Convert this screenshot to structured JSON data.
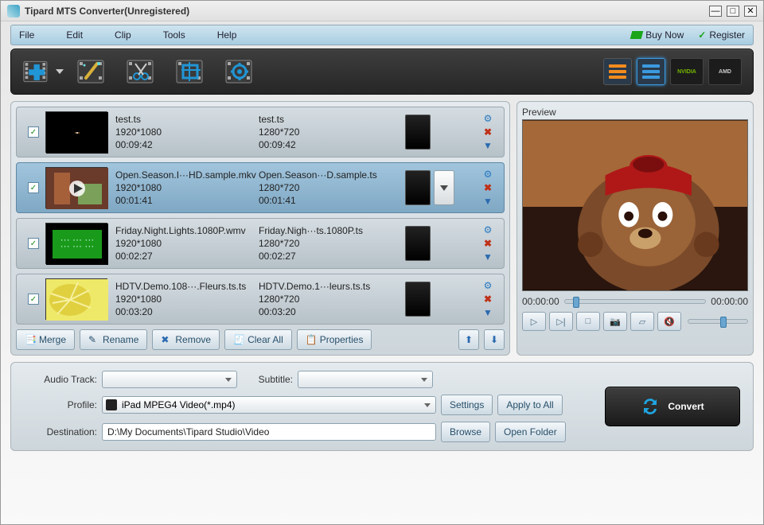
{
  "window": {
    "title": "Tipard MTS Converter(Unregistered)"
  },
  "menu": {
    "file": "File",
    "edit": "Edit",
    "clip": "Clip",
    "tools": "Tools",
    "help": "Help",
    "buy_now": "Buy Now",
    "register": "Register"
  },
  "filelist": {
    "rows": [
      {
        "checked": "✓",
        "src_name": "test.ts",
        "src_res": "1920*1080",
        "src_dur": "00:09:42",
        "out_name": "test.ts",
        "out_res": "1280*720",
        "out_dur": "00:09:42"
      },
      {
        "checked": "✓",
        "src_name": "Open.Season.I···HD.sample.mkv",
        "src_res": "1920*1080",
        "src_dur": "00:01:41",
        "out_name": "Open.Season···D.sample.ts",
        "out_res": "1280*720",
        "out_dur": "00:01:41"
      },
      {
        "checked": "✓",
        "src_name": "Friday.Night.Lights.1080P.wmv",
        "src_res": "1920*1080",
        "src_dur": "00:02:27",
        "out_name": "Friday.Nigh···ts.1080P.ts",
        "out_res": "1280*720",
        "out_dur": "00:02:27"
      },
      {
        "checked": "✓",
        "src_name": "HDTV.Demo.108···.Fleurs.ts.ts",
        "src_res": "1920*1080",
        "src_dur": "00:03:20",
        "out_name": "HDTV.Demo.1···leurs.ts.ts",
        "out_res": "1280*720",
        "out_dur": "00:03:20"
      }
    ],
    "buttons": {
      "merge": "Merge",
      "rename": "Rename",
      "remove": "Remove",
      "clear_all": "Clear All",
      "properties": "Properties"
    }
  },
  "preview": {
    "label": "Preview",
    "time_left": "00:00:00",
    "time_right": "00:00:00"
  },
  "settings": {
    "audio_track_label": "Audio Track:",
    "subtitle_label": "Subtitle:",
    "profile_label": "Profile:",
    "profile_value": "iPad MPEG4 Video(*.mp4)",
    "settings_btn": "Settings",
    "apply_all_btn": "Apply to All",
    "destination_label": "Destination:",
    "destination_value": "D:\\My Documents\\Tipard Studio\\Video",
    "browse_btn": "Browse",
    "open_folder_btn": "Open Folder",
    "convert_btn": "Convert"
  },
  "gpu": {
    "nvidia": "NVIDIA",
    "amd": "AMD"
  }
}
